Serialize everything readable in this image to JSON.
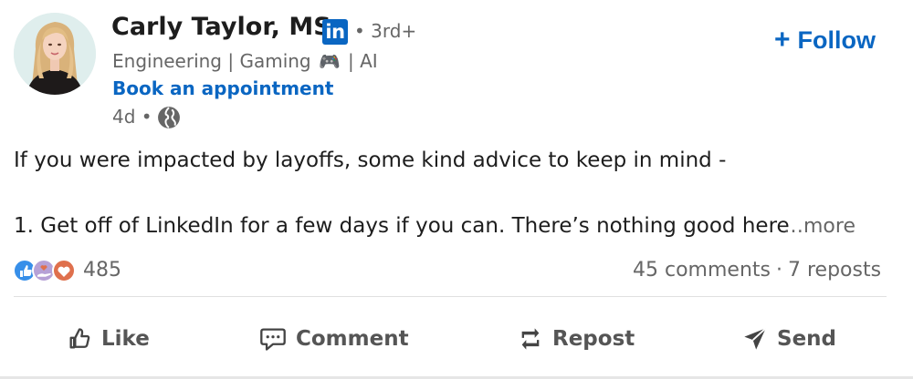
{
  "author": {
    "name": "Carly Taylor, MSc",
    "linkedin_badge": "in",
    "degree": "• 3rd+",
    "headline_part1": "Engineering | Gaming",
    "headline_emoji": "🎮",
    "headline_part2": "| AI",
    "appointment_link": "Book an appointment",
    "time": "4d •"
  },
  "follow": {
    "plus": "+",
    "label": "Follow"
  },
  "post": {
    "line1": "If you were impacted by layoffs, some kind advice to keep in mind -",
    "line2": "1. Get off of LinkedIn for a few days if you can. There’s nothing good here",
    "more": "…more"
  },
  "social": {
    "reaction_count": "485",
    "comments": "45 comments",
    "separator": "·",
    "reposts": "7 reposts"
  },
  "actions": {
    "like": "Like",
    "comment": "Comment",
    "repost": "Repost",
    "send": "Send"
  },
  "colors": {
    "brand_blue": "#0a66c2",
    "secondary_text": "#666666",
    "love_red": "#df704d"
  }
}
